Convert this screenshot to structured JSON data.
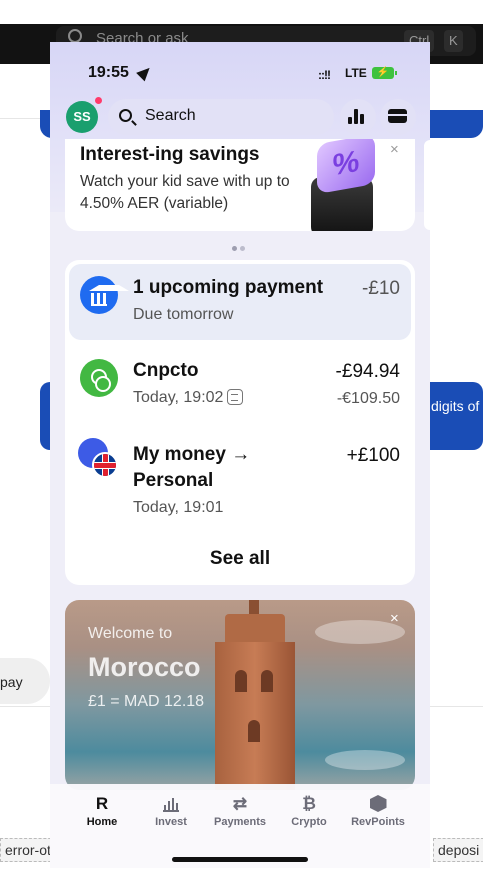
{
  "background": {
    "search_placeholder": "Search or ask",
    "kbd_ctrl": "Ctrl",
    "kbd_k": "K",
    "side_text": "digits of",
    "pay_text": "pay",
    "chip_left": "error-ot",
    "chip_right": "deposi"
  },
  "status_bar": {
    "time": "19:55",
    "network": "LTE"
  },
  "header": {
    "avatar_initials": "SS",
    "search_label": "Search"
  },
  "promo": {
    "title": "Interest-ing savings",
    "body": "Watch your kid save with up to 4.50% AER (variable)",
    "close": "×",
    "badge": "%"
  },
  "transactions": {
    "upcoming": {
      "title": "1 upcoming payment",
      "subtitle": "Due tomorrow",
      "amount": "-£10"
    },
    "items": [
      {
        "title": "Cnpcto",
        "subtitle": "Today, 19:02",
        "amount": "-£94.94",
        "amount_secondary": "-€109.50"
      },
      {
        "title": "My money → Personal",
        "subtitle": "Today, 19:01",
        "amount": "+£100"
      }
    ],
    "see_all": "See all"
  },
  "travel": {
    "welcome": "Welcome to",
    "country": "Morocco",
    "rate": "£1 = MAD 12.18",
    "close": "×"
  },
  "tabbar": {
    "tabs": [
      {
        "label": "Home",
        "icon": "R"
      },
      {
        "label": "Invest",
        "icon": "invest-icon"
      },
      {
        "label": "Payments",
        "icon": "⇄"
      },
      {
        "label": "Crypto",
        "icon": "₿"
      },
      {
        "label": "RevPoints",
        "icon": "revpoints-icon"
      }
    ]
  },
  "colors": {
    "accent_blue": "#1f6bf0",
    "crypto_green": "#42b842",
    "avatar_green": "#1a9f6e"
  }
}
